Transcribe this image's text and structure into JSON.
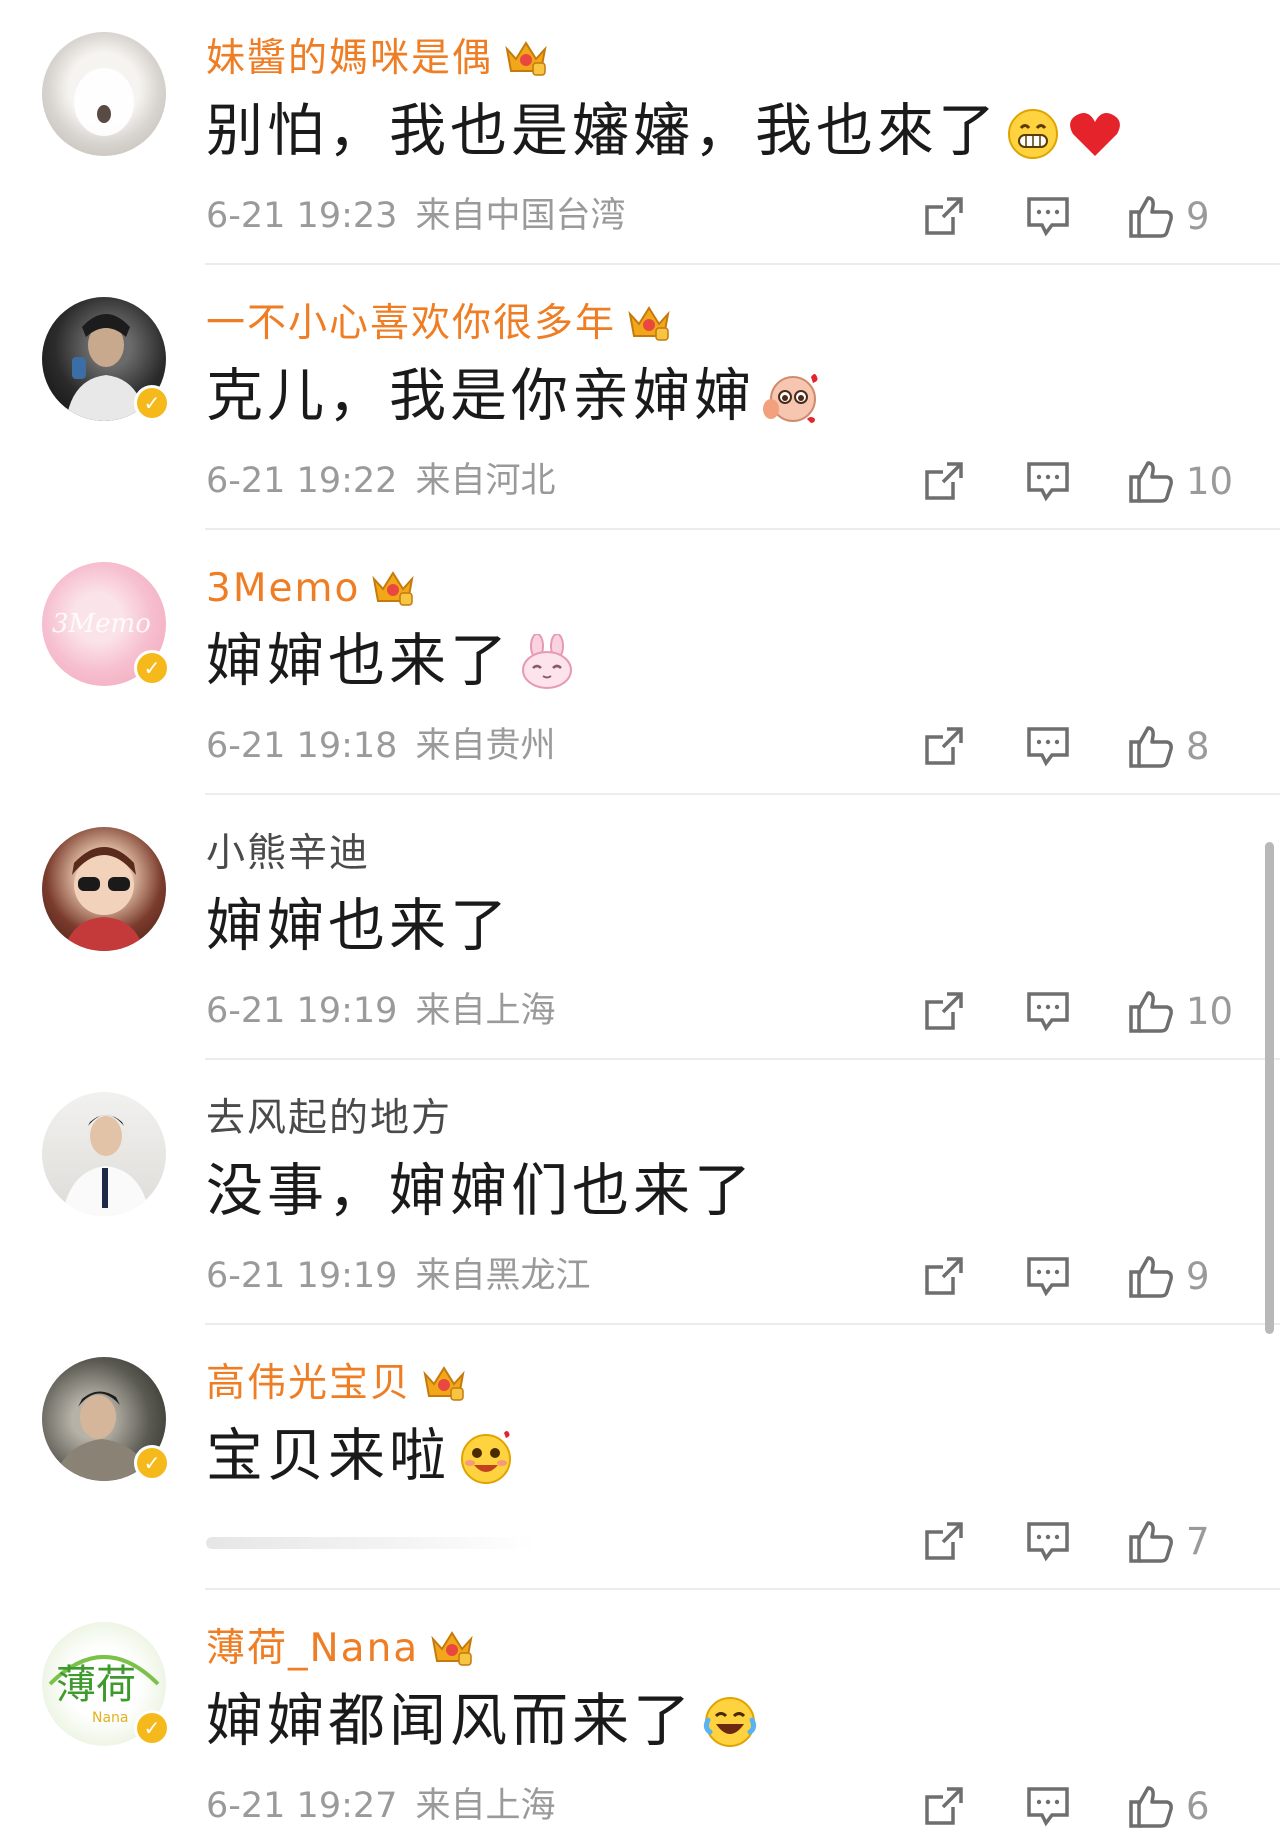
{
  "accent_colors": {
    "vip_name": "#ef7d24",
    "plain_name": "#4a4a4a",
    "meta": "#9a9a9a",
    "verified_badge": "#f5b91b"
  },
  "comments": [
    {
      "username": "妹醬的媽咪是偶",
      "vip": true,
      "verified": false,
      "text": "别怕，我也是嬸嬸，我也來了",
      "emojis": [
        "grin-emoji",
        "heart-emoji"
      ],
      "time": "6-21 19:23",
      "location": "来自中国台湾",
      "likes": "9"
    },
    {
      "username": "一不小心喜欢你很多年",
      "vip": true,
      "verified": true,
      "text": "克儿，我是你亲婶婶",
      "emojis": [
        "shy-emoji"
      ],
      "time": "6-21 19:22",
      "location": "来自河北",
      "likes": "10"
    },
    {
      "username": "3Memo",
      "vip": true,
      "verified": true,
      "text": "婶婶也来了",
      "emojis": [
        "bunny-emoji"
      ],
      "time": "6-21 19:18",
      "location": "来自贵州",
      "likes": "8"
    },
    {
      "username": "小熊辛迪",
      "vip": false,
      "verified": false,
      "text": "婶婶也来了",
      "emojis": [],
      "time": "6-21 19:19",
      "location": "来自上海",
      "likes": "10"
    },
    {
      "username": "去风起的地方",
      "vip": false,
      "verified": false,
      "text": "没事，婶婶们也来了",
      "emojis": [],
      "time": "6-21 19:19",
      "location": "来自黑龙江",
      "likes": "9"
    },
    {
      "username": "高伟光宝贝",
      "vip": true,
      "verified": true,
      "text": "宝贝来啦",
      "emojis": [
        "love-emoji"
      ],
      "time": "",
      "location": "",
      "likes": "7"
    },
    {
      "username": "薄荷_Nana",
      "vip": true,
      "verified": true,
      "text": "婶婶都闻风而来了",
      "emojis": [
        "laugh-cry-emoji"
      ],
      "time": "6-21 19:27",
      "location": "来自上海",
      "likes": "6"
    }
  ]
}
